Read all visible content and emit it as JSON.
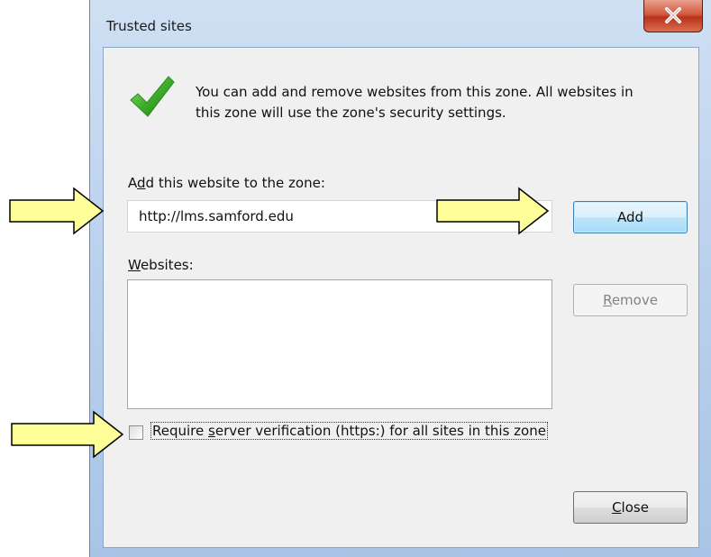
{
  "window": {
    "title": "Trusted sites"
  },
  "info": {
    "line1": "You can add and remove websites from this zone. All websites in",
    "line2": "this zone will use the zone's security settings."
  },
  "add_section": {
    "label_pre": "A",
    "label_u": "d",
    "label_post": "d this website to the zone:",
    "url_value": "http://lms.samford.edu",
    "add_label": "Add"
  },
  "websites": {
    "label_u": "W",
    "label_post": "ebsites:",
    "items": [],
    "remove_pre": "",
    "remove_u": "R",
    "remove_post": "emove"
  },
  "verification": {
    "checked": false,
    "label_pre": "Require ",
    "label_u": "s",
    "label_post": "erver verification (https:) for all sites in this zone"
  },
  "footer": {
    "close_u": "C",
    "close_post": "lose"
  },
  "colors": {
    "arrow_fill": "#ffff99",
    "arrow_stroke": "#000000",
    "check_green": "#3fae2a",
    "add_border": "#3c7fb1"
  },
  "icons": [
    "close-icon",
    "checkmark-icon",
    "arrow-icon"
  ]
}
